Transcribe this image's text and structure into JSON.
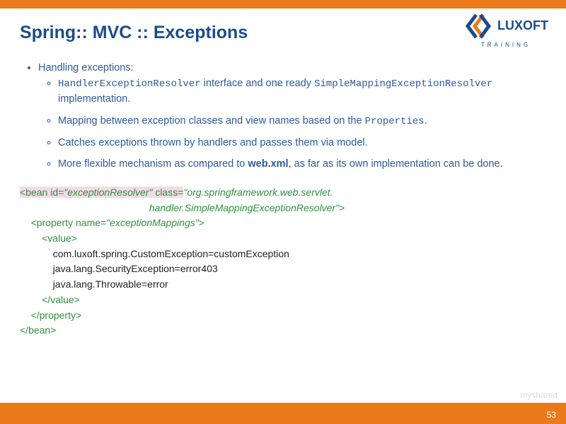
{
  "brand": {
    "name": "LUXOFT",
    "subtitle": "TRAINING"
  },
  "title": "Spring:: MVC :: Exceptions",
  "content": {
    "heading": "Handling exceptions:",
    "bullets": [
      {
        "pre": "",
        "code1": "HandlerExceptionResolver",
        "mid": " interface and one ready ",
        "code2": "SimpleMappingExceptionResolver",
        "post": " implementation."
      },
      {
        "pre": "Mapping between exception classes and view names based on the ",
        "code1": "Properties",
        "post": "."
      },
      {
        "plain": "Catches exceptions thrown by handlers and passes them via model."
      },
      {
        "pre": "More flexible mechanism as compared to ",
        "bold": "web.xml",
        "post": ", as far as its own implementation can be done."
      }
    ]
  },
  "code": {
    "bean_open": "<bean ",
    "bean_id_attr": "id=",
    "bean_id_val": "\"exceptionResolver\" ",
    "bean_class_attr": "class=",
    "bean_class_val1": "\"org.springframework.web.servlet.",
    "bean_class_val2": "handler.SimpleMappingExceptionResolver\"",
    "angle_close": ">",
    "prop_open": "<property ",
    "prop_name_attr": "name=",
    "prop_name_val": "\"exceptionMappings\"",
    "value_open": "<value>",
    "mapping1": "com.luxoft.spring.CustomException=customException",
    "mapping2": "java.lang.SecurityException=error403",
    "mapping3": "java.lang.Throwable=error",
    "value_close": "</value>",
    "prop_close": "</property>",
    "bean_close": "</bean>"
  },
  "footer": {
    "page_number": "53",
    "watermark": "myshared"
  }
}
